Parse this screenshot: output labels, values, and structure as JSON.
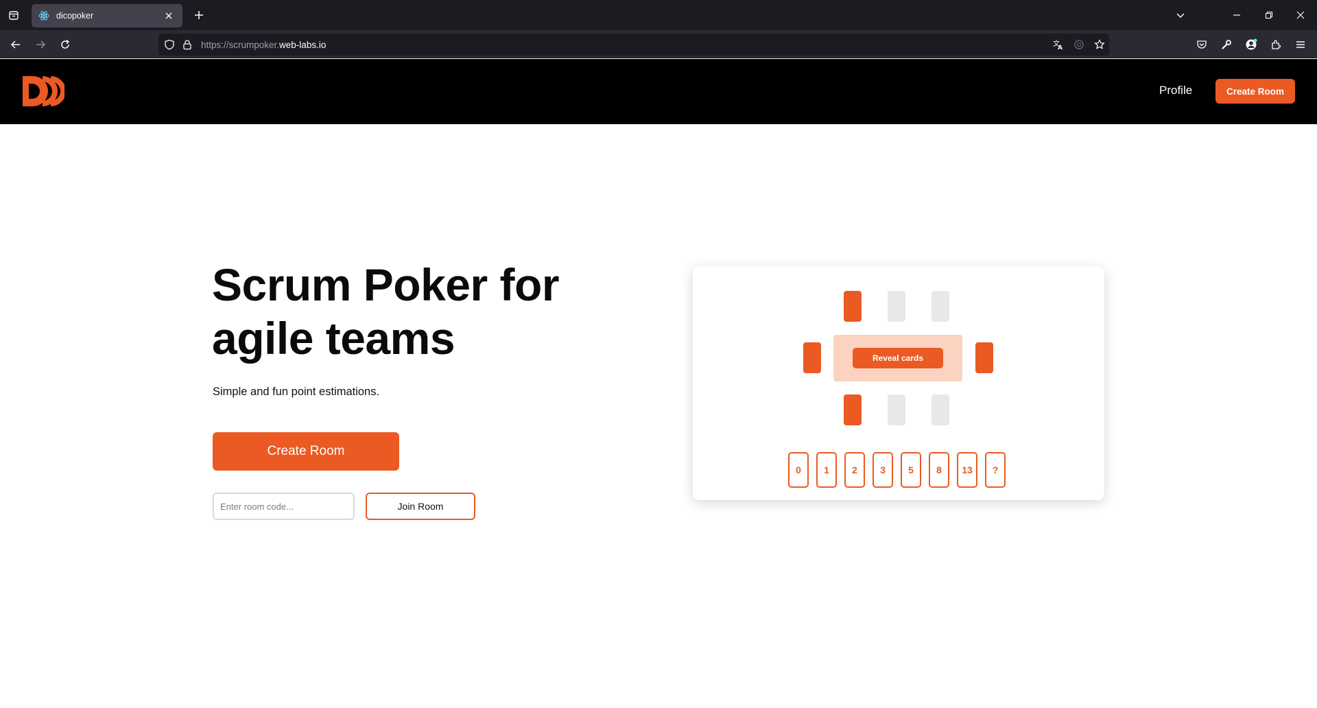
{
  "browser": {
    "tab": {
      "title": "dicopoker"
    },
    "url": {
      "prefix": "https://scrumpoker.",
      "domain": "web-labs.io"
    }
  },
  "header": {
    "profile_label": "Profile",
    "create_room_label": "Create Room"
  },
  "hero": {
    "title": "Scrum Poker for agile teams",
    "subtitle": "Simple and fun point estimations.",
    "create_room_label": "Create Room",
    "room_code_placeholder": "Enter room code...",
    "join_room_label": "Join Room"
  },
  "illustration": {
    "reveal_label": "Reveal cards",
    "cards": [
      "0",
      "1",
      "2",
      "3",
      "5",
      "8",
      "13",
      "?"
    ]
  },
  "colors": {
    "accent": "#eb5a22",
    "table": "#fcd3c0",
    "seat_empty": "#e8e8e8",
    "header_bg": "#000000"
  }
}
